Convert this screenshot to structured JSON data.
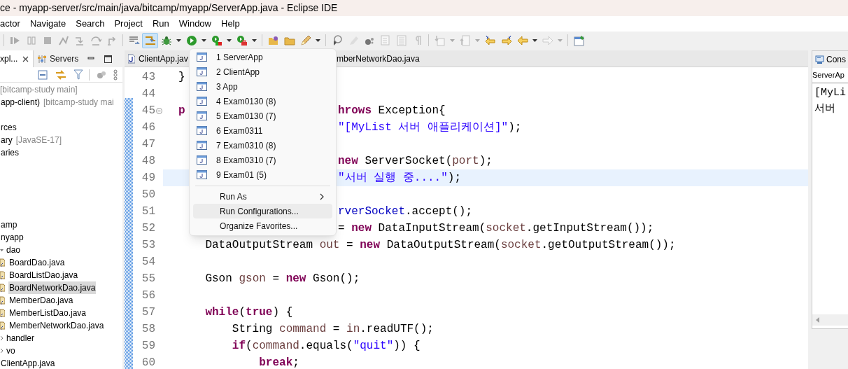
{
  "window": {
    "title": "ce - myapp-server/src/main/java/bitcamp/myapp/ServerApp.java - Eclipse IDE"
  },
  "menu_bar": [
    "actor",
    "Navigate",
    "Search",
    "Project",
    "Run",
    "Window",
    "Help"
  ],
  "toolbar": [
    {
      "kind": "separator"
    },
    {
      "kind": "button",
      "disabled": true,
      "selected": false,
      "dropdown": false
    },
    {
      "kind": "button",
      "disabled": true,
      "selected": false,
      "dropdown": false
    },
    {
      "kind": "button",
      "disabled": true,
      "selected": false,
      "dropdown": false
    },
    {
      "kind": "button",
      "disabled": true,
      "selected": false,
      "dropdown": false
    },
    {
      "kind": "button",
      "disabled": true,
      "selected": false,
      "dropdown": false
    },
    {
      "kind": "button",
      "disabled": true,
      "selected": false,
      "dropdown": false
    },
    {
      "kind": "button",
      "disabled": true,
      "selected": false,
      "dropdown": false
    },
    {
      "kind": "separator"
    },
    {
      "kind": "button",
      "disabled": false,
      "selected": false,
      "dropdown": false
    },
    {
      "kind": "button",
      "disabled": false,
      "selected": true,
      "dropdown": false
    },
    {
      "kind": "button",
      "disabled": false,
      "selected": false,
      "dropdown": true
    },
    {
      "kind": "button",
      "disabled": false,
      "selected": false,
      "dropdown": true
    },
    {
      "kind": "button",
      "disabled": false,
      "selected": false,
      "dropdown": true
    },
    {
      "kind": "button",
      "disabled": false,
      "selected": false,
      "dropdown": true
    },
    {
      "kind": "separator"
    },
    {
      "kind": "button",
      "disabled": false,
      "selected": false,
      "dropdown": false
    },
    {
      "kind": "button",
      "disabled": false,
      "selected": false,
      "dropdown": false
    },
    {
      "kind": "button",
      "disabled": false,
      "selected": false,
      "dropdown": true
    },
    {
      "kind": "separator"
    },
    {
      "kind": "button",
      "disabled": false,
      "selected": false,
      "dropdown": false
    },
    {
      "kind": "button",
      "disabled": true,
      "selected": false,
      "dropdown": false
    },
    {
      "kind": "button",
      "disabled": false,
      "selected": false,
      "dropdown": false
    },
    {
      "kind": "button",
      "disabled": true,
      "selected": false,
      "dropdown": false
    },
    {
      "kind": "button",
      "disabled": true,
      "selected": false,
      "dropdown": false
    },
    {
      "kind": "button",
      "disabled": true,
      "selected": false,
      "dropdown": false
    },
    {
      "kind": "separator"
    },
    {
      "kind": "button",
      "disabled": true,
      "selected": false,
      "dropdown": true
    },
    {
      "kind": "button",
      "disabled": true,
      "selected": false,
      "dropdown": true
    },
    {
      "kind": "button",
      "disabled": false,
      "selected": false,
      "dropdown": false
    },
    {
      "kind": "button",
      "disabled": false,
      "selected": false,
      "dropdown": false
    },
    {
      "kind": "button",
      "disabled": false,
      "selected": false,
      "dropdown": true
    },
    {
      "kind": "button",
      "disabled": true,
      "selected": false,
      "dropdown": true
    },
    {
      "kind": "separator"
    },
    {
      "kind": "button",
      "disabled": false,
      "selected": false,
      "dropdown": false
    }
  ],
  "sidebar": {
    "tabs": [
      {
        "label": "xpl...",
        "selected": true,
        "closable": true
      },
      {
        "label": "Servers",
        "selected": false,
        "closable": false
      }
    ],
    "tree_groups": [
      [
        {
          "decoration": "[bitcamp-study main]",
          "selected": false
        },
        {
          "label": "app-client)",
          "decoration": "[bitcamp-study mai",
          "selected": false
        }
      ],
      [
        {
          "label": "rces",
          "selected": false
        },
        {
          "label": "ary",
          "decoration": "[JavaSE-17]",
          "selected": false
        },
        {
          "label": "aries",
          "selected": false
        }
      ],
      [
        {
          "label": "amp",
          "selected": false,
          "children": [
            {
              "label": "nyapp",
              "selected": false,
              "children": [
                {
                  "label": "dao",
                  "selected": false,
                  "expanded": true,
                  "children": [
                    {
                      "label": "BoardDao.java",
                      "selected": false
                    },
                    {
                      "label": "BoardListDao.java",
                      "selected": false
                    },
                    {
                      "label": "BoardNetworkDao.java",
                      "selected": true
                    },
                    {
                      "label": "MemberDao.java",
                      "selected": false
                    },
                    {
                      "label": "MemberListDao.java",
                      "selected": false
                    },
                    {
                      "label": "MemberNetworkDao.java",
                      "selected": false
                    }
                  ]
                },
                {
                  "label": "handler",
                  "selected": false,
                  "expanded": false
                },
                {
                  "label": "vo",
                  "selected": false,
                  "expanded": false
                }
              ]
            },
            {
              "label": "ClientApp.java",
              "selected": false
            }
          ]
        }
      ]
    ]
  },
  "editor": {
    "tabs": [
      {
        "label": "ClientApp.jav"
      },
      {
        "label": "mberNetworkDao.java"
      }
    ],
    "lines": [
      {
        "number": "43",
        "current": false,
        "foldable": false,
        "code": [
          {
            "text": "}",
            "kind": "plain"
          }
        ]
      },
      {
        "number": "44",
        "current": false,
        "foldable": false
      },
      {
        "number": "45",
        "current": false,
        "foldable": true,
        "code": [
          {
            "text": "p",
            "kind": "kw"
          }
        ],
        "after_menu": [
          {
            "text": "hrows",
            "kind": "kw"
          },
          {
            "text": " Exception{",
            "kind": "plain"
          }
        ]
      },
      {
        "number": "46",
        "current": false,
        "foldable": false,
        "after_menu": [
          {
            "text": "\"[MyList 서버 애플리케이션]\"",
            "kind": "str"
          },
          {
            "text": ");",
            "kind": "plain"
          }
        ]
      },
      {
        "number": "47",
        "current": false,
        "foldable": false
      },
      {
        "number": "48",
        "current": false,
        "foldable": false,
        "after_menu": [
          {
            "text": "new",
            "kind": "kw"
          },
          {
            "text": " ServerSocket(",
            "kind": "plain"
          },
          {
            "text": "port",
            "kind": "var"
          },
          {
            "text": ");",
            "kind": "plain"
          }
        ]
      },
      {
        "number": "49",
        "current": true,
        "foldable": false,
        "after_menu": [
          {
            "text": "\"서버 실행 중....\"",
            "kind": "str"
          },
          {
            "text": ");",
            "kind": "plain"
          }
        ]
      },
      {
        "number": "50",
        "current": false,
        "foldable": false
      },
      {
        "number": "51",
        "current": false,
        "foldable": false,
        "after_menu": [
          {
            "text": "rverSocket",
            "kind": "field"
          },
          {
            "text": ".accept();",
            "kind": "plain"
          }
        ]
      },
      {
        "number": "52",
        "current": false,
        "foldable": false,
        "after_menu": [
          {
            "text": "= ",
            "kind": "plain"
          },
          {
            "text": "new",
            "kind": "kw"
          },
          {
            "text": " DataInputStream(",
            "kind": "plain"
          },
          {
            "text": "socket",
            "kind": "var"
          },
          {
            "text": ".getInputStream());",
            "kind": "plain"
          }
        ]
      },
      {
        "number": "53",
        "current": false,
        "foldable": false,
        "code": [
          {
            "text": "    DataOutputStream ",
            "kind": "plain"
          },
          {
            "text": "out",
            "kind": "var"
          },
          {
            "text": " = ",
            "kind": "plain"
          },
          {
            "text": "new",
            "kind": "kw"
          },
          {
            "text": " DataOutputStream(",
            "kind": "plain"
          },
          {
            "text": "socket",
            "kind": "var"
          },
          {
            "text": ".getOutputStream());",
            "kind": "plain"
          }
        ]
      },
      {
        "number": "54",
        "current": false,
        "foldable": false
      },
      {
        "number": "55",
        "current": false,
        "foldable": false,
        "code": [
          {
            "text": "    Gson ",
            "kind": "plain"
          },
          {
            "text": "gson",
            "kind": "var"
          },
          {
            "text": " = ",
            "kind": "plain"
          },
          {
            "text": "new",
            "kind": "kw"
          },
          {
            "text": " Gson();",
            "kind": "plain"
          }
        ]
      },
      {
        "number": "56",
        "current": false,
        "foldable": false
      },
      {
        "number": "57",
        "current": false,
        "foldable": false,
        "code": [
          {
            "text": "    while",
            "kind": "kw"
          },
          {
            "text": "(",
            "kind": "plain"
          },
          {
            "text": "true",
            "kind": "kw"
          },
          {
            "text": ") {",
            "kind": "plain"
          }
        ]
      },
      {
        "number": "58",
        "current": false,
        "foldable": false,
        "code": [
          {
            "text": "        String ",
            "kind": "plain"
          },
          {
            "text": "command",
            "kind": "var"
          },
          {
            "text": " = ",
            "kind": "plain"
          },
          {
            "text": "in",
            "kind": "var"
          },
          {
            "text": ".readUTF();",
            "kind": "plain"
          }
        ]
      },
      {
        "number": "59",
        "current": false,
        "foldable": false,
        "code": [
          {
            "text": "        if",
            "kind": "kw"
          },
          {
            "text": "(",
            "kind": "plain"
          },
          {
            "text": "command",
            "kind": "var"
          },
          {
            "text": ".equals(",
            "kind": "plain"
          },
          {
            "text": "\"quit\"",
            "kind": "str"
          },
          {
            "text": ")) {",
            "kind": "plain"
          }
        ]
      },
      {
        "number": "60",
        "current": false,
        "foldable": false,
        "code": [
          {
            "text": "            break",
            "kind": "kw"
          },
          {
            "text": ";",
            "kind": "plain"
          }
        ]
      }
    ]
  },
  "console": {
    "tab": "Cons",
    "launch": "ServerAp",
    "output": [
      "[MyLi",
      "서버"
    ]
  },
  "run_menu": {
    "items": [
      {
        "kind": "launch",
        "label": "1 ServerApp",
        "selected": false
      },
      {
        "kind": "launch",
        "label": "2 ClientApp",
        "selected": false
      },
      {
        "kind": "launch",
        "label": "3 App",
        "selected": false
      },
      {
        "kind": "launch",
        "label": "4 Exam0130 (8)",
        "selected": false
      },
      {
        "kind": "launch",
        "label": "5 Exam0130 (7)",
        "selected": false
      },
      {
        "kind": "launch",
        "label": "6 Exam0311",
        "selected": false
      },
      {
        "kind": "launch",
        "label": "7 Exam0310 (8)",
        "selected": false
      },
      {
        "kind": "launch",
        "label": "8 Exam0310 (7)",
        "selected": false
      },
      {
        "kind": "launch",
        "label": "9 Exam01 (5)",
        "selected": false
      },
      {
        "kind": "separator"
      },
      {
        "kind": "submenu",
        "label": "Run As",
        "selected": false
      },
      {
        "kind": "action",
        "label": "Run Configurations...",
        "selected": true
      },
      {
        "kind": "action",
        "label": "Organize Favorites...",
        "selected": false
      }
    ]
  }
}
